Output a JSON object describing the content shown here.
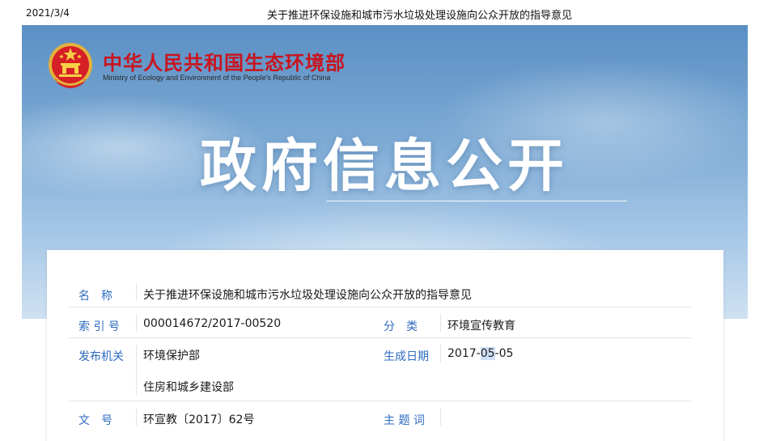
{
  "print_header": {
    "date": "2021/3/4",
    "title": "关于推进环保设施和城市污水垃圾处理设施向公众开放的指导意见"
  },
  "banner": {
    "ministry_cn": "中华人民共和国生态环境部",
    "ministry_en": "Ministry of Ecology and Environment of the People's Republic of China",
    "heading": "政府信息公开"
  },
  "info": {
    "name_label": "名　称",
    "name_value": "关于推进环保设施和城市污水垃圾处理设施向公众开放的指导意见",
    "index_label": "索 引 号",
    "index_value": "000014672/2017-00520",
    "category_label": "分　类",
    "category_value": "环境宣传教育",
    "issuer_label": "发布机关",
    "issuer_value_1": "环境保护部",
    "issuer_value_2": "住房和城乡建设部",
    "date_label": "生成日期",
    "date_prefix": "2017-",
    "date_month": "05",
    "date_suffix": "-05",
    "doc_no_label": "文　号",
    "doc_no_value": "环宣教〔2017〕62号",
    "keywords_label": "主 题 词",
    "keywords_value": ""
  },
  "colors": {
    "label": "#2d6bc0",
    "ministry_red": "#c8141e",
    "banner_sky": "#78a7d3"
  },
  "icons": {
    "emblem": "national-emblem-icon"
  }
}
